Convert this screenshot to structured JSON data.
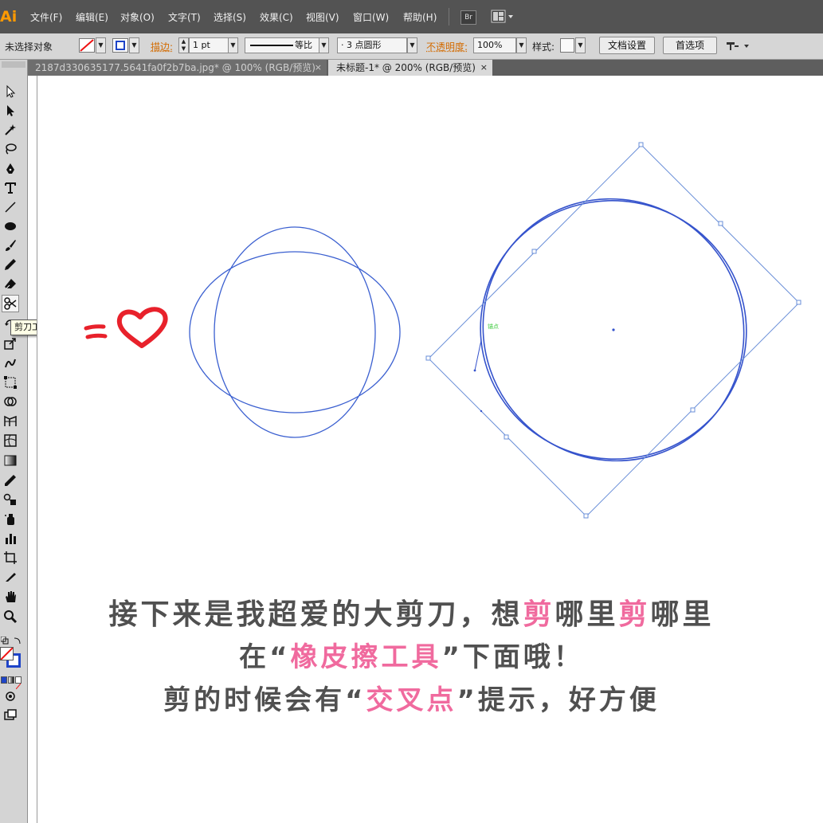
{
  "app": {
    "logo": "Ai"
  },
  "menu": {
    "items": [
      "文件(F)",
      "编辑(E)",
      "对象(O)",
      "文字(T)",
      "选择(S)",
      "效果(C)",
      "视图(V)",
      "窗口(W)",
      "帮助(H)"
    ],
    "bridge_label": "Br",
    "workspace_icon": "layout-grid-icon"
  },
  "control_bar": {
    "selection_status": "未选择对象",
    "stroke_label": "描边:",
    "stroke_weight": "1 pt",
    "stroke_profile": "等比",
    "brush_preset": "3 点圆形",
    "opacity_label": "不透明度:",
    "opacity_value": "100%",
    "style_label": "样式:",
    "doc_setup_button": "文档设置",
    "preferences_button": "首选项"
  },
  "tabs": [
    {
      "label": "2187d330635177.5641fa0f2b7ba.jpg* @ 100% (RGB/预览)",
      "active": false,
      "close": "×"
    },
    {
      "label": "未标题-1* @ 200% (RGB/预览)",
      "active": true,
      "close": "×"
    }
  ],
  "tooltip": {
    "text": "剪刀工具 (C)"
  },
  "annotation": {
    "doodle_equals": "=",
    "anchor_hint": "锚点"
  },
  "caption": {
    "line1": {
      "part1": "接下来是我超爱的大剪刀，想",
      "hl1": "剪",
      "part2": "哪里",
      "hl2": "剪",
      "part3": "哪里"
    },
    "line2": {
      "part1": "在“",
      "hl": "橡皮擦工具",
      "part2": "”下面哦！"
    },
    "line3": {
      "part1": "剪的时候会有“",
      "hl": "交叉点",
      "part2": "”提示，好方便"
    }
  },
  "colors": {
    "path_stroke": "#3a5fd0",
    "bbox_stroke": "#6a8fd8",
    "heart": "#e8212b",
    "highlight_text": "#f06a9e",
    "caption_text": "#505050",
    "menu_bg": "#535353",
    "accent_orange": "#d36b00"
  }
}
